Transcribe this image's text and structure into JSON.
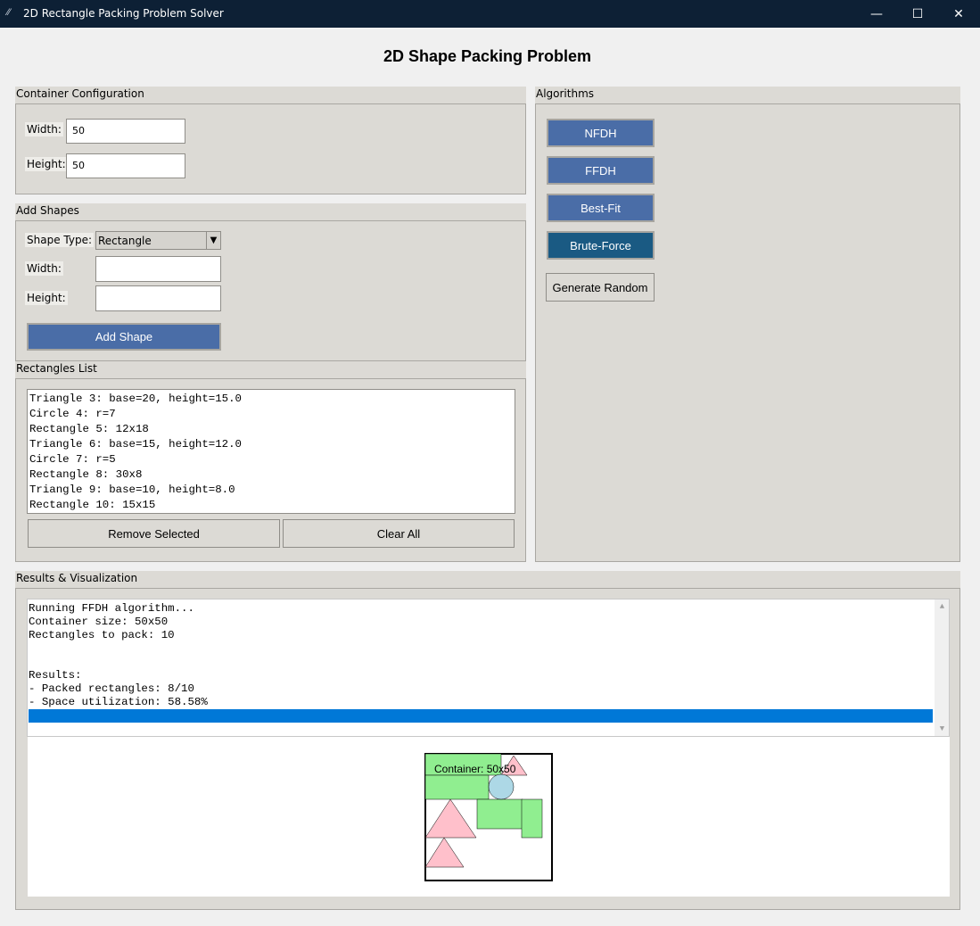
{
  "window": {
    "title": "2D Rectangle Packing Problem Solver",
    "icon": "feather-icon",
    "controls": {
      "minimize": "—",
      "maximize": "☐",
      "close": "✕"
    }
  },
  "heading": "2D Shape Packing Problem",
  "container_config": {
    "label": "Container Configuration",
    "width_label": "Width:",
    "width_value": "50",
    "height_label": "Height:",
    "height_value": "50"
  },
  "add_shapes": {
    "label": "Add Shapes",
    "shape_type_label": "Shape Type:",
    "shape_type_value": "Rectangle",
    "width_label": "Width:",
    "width_value": "",
    "height_label": "Height:",
    "height_value": "",
    "add_button": "Add Shape"
  },
  "rect_list": {
    "label": "Rectangles List",
    "items": [
      "Triangle 3: base=20, height=15.0",
      "Circle 4: r=7",
      "Rectangle 5: 12x18",
      "Triangle 6: base=15, height=12.0",
      "Circle 7: r=5",
      "Rectangle 8: 30x8",
      "Triangle 9: base=10, height=8.0",
      "Rectangle 10: 15x15"
    ],
    "remove_button": "Remove Selected",
    "clear_button": "Clear All"
  },
  "algorithms": {
    "label": "Algorithms",
    "buttons": [
      "NFDH",
      "FFDH",
      "Best-Fit",
      "Brute-Force"
    ],
    "generate_button": "Generate Random"
  },
  "results": {
    "label": "Results & Visualization",
    "log_lines": [
      "Running FFDH algorithm...",
      "Container size: 50x50",
      "Rectangles to pack: 10",
      "",
      "",
      "Results:",
      "- Packed rectangles: 8/10",
      "- Space utilization: 58.58%"
    ],
    "container_caption": "Container: 50x50"
  },
  "colors": {
    "rectangle_fill": "#90ee90",
    "triangle_fill": "#ffc0cb",
    "circle_fill": "#add8e6",
    "button_blue": "#4a6da7",
    "button_teal": "#1a5a83",
    "selection": "#0078d7"
  }
}
